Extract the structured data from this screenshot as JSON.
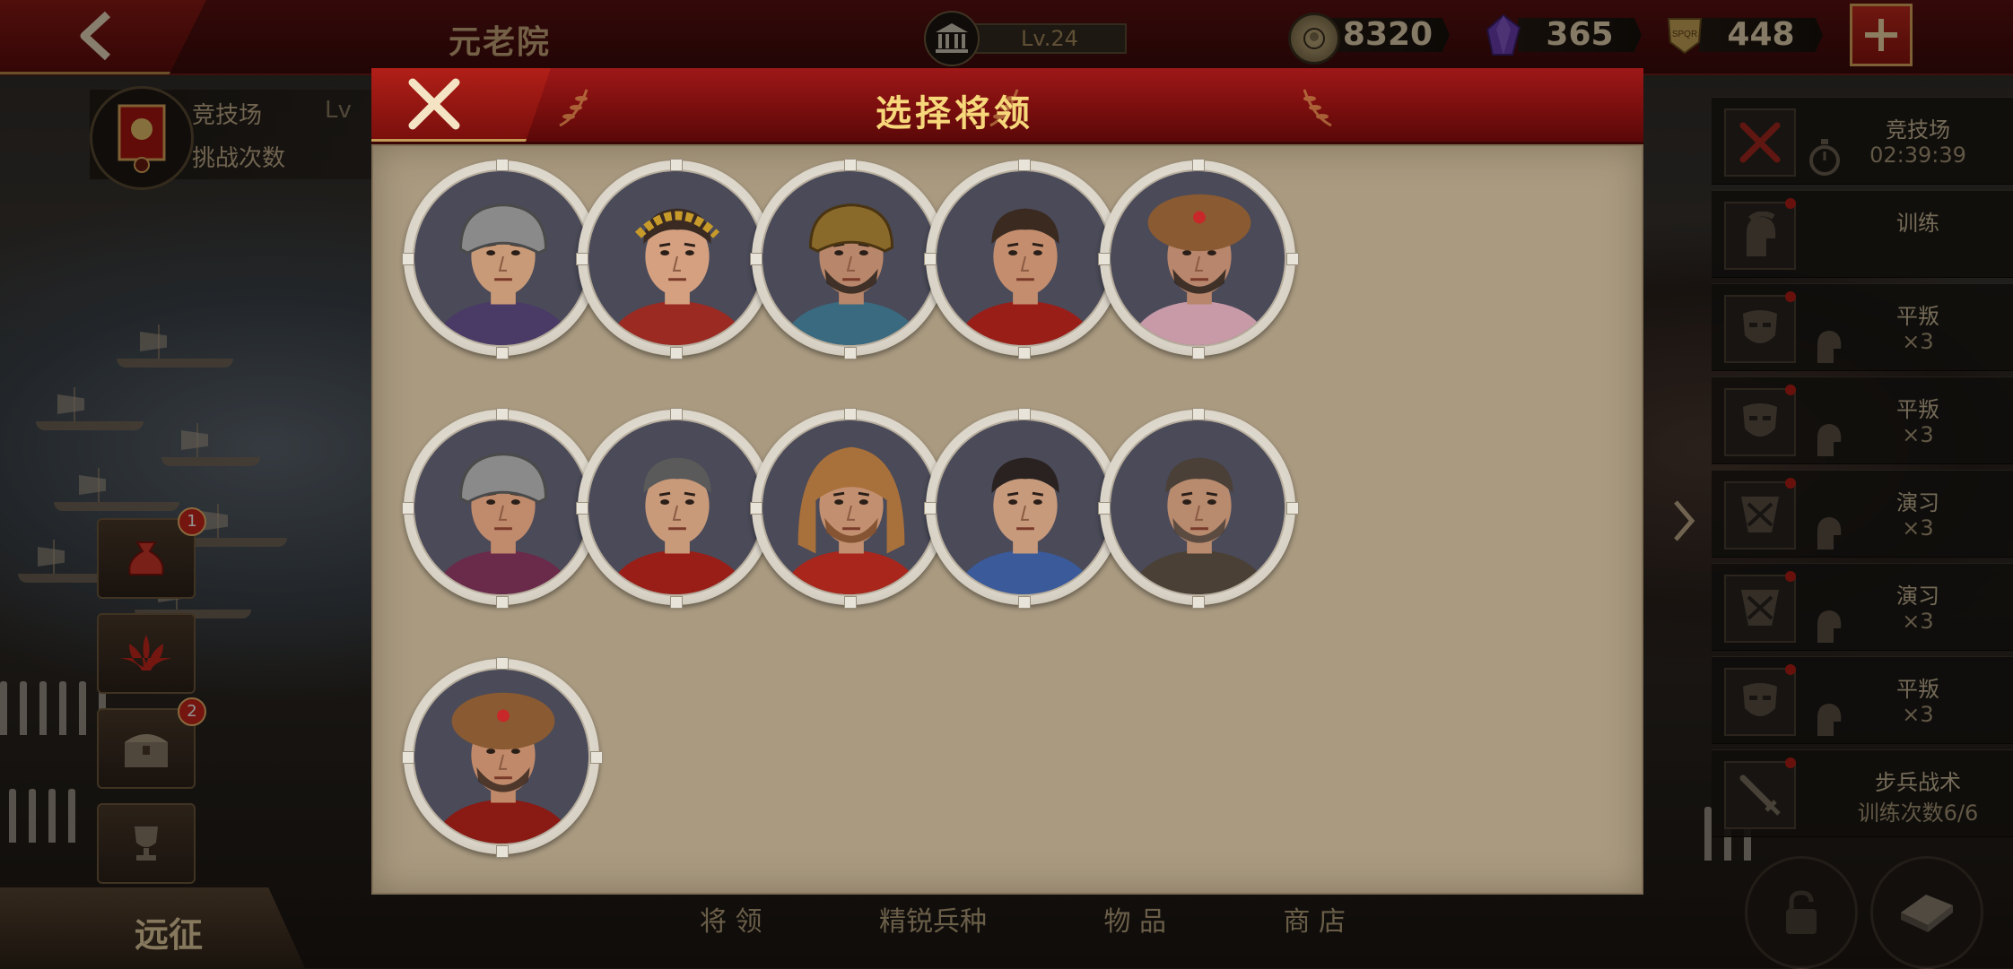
{
  "top_bar": {
    "screen_title": "元老院",
    "level": "Lv.24",
    "resources": [
      {
        "name": "gold",
        "icon": "gold-coin-icon",
        "amount": "8320"
      },
      {
        "name": "gem",
        "icon": "purple-gem-icon",
        "amount": "365"
      },
      {
        "name": "spqr",
        "icon": "spqr-banner-icon",
        "amount": "448"
      }
    ]
  },
  "left_panel": {
    "arena_label": "竞技场",
    "arena_level_partial": "Lv",
    "challenge_label": "挑战次数",
    "expedition_label": "远征",
    "badges": [
      "1",
      "2"
    ]
  },
  "right_panel": {
    "tasks": [
      {
        "icon": "crossed-swords-icon",
        "title": "竞技场",
        "subtitle": "02:39:39"
      },
      {
        "icon": "helmet-icon",
        "title": "训练",
        "subtitle": ""
      },
      {
        "icon": "mask-icon",
        "title": "平叛",
        "subtitle": "×3"
      },
      {
        "icon": "mask-icon",
        "title": "平叛",
        "subtitle": "×3"
      },
      {
        "icon": "crossed-emblem-icon",
        "title": "演习",
        "subtitle": "×3"
      },
      {
        "icon": "crossed-emblem-icon",
        "title": "演习",
        "subtitle": "×3"
      },
      {
        "icon": "mask-icon",
        "title": "平叛",
        "subtitle": "×3"
      },
      {
        "icon": "sword-icon",
        "title": "步兵战术",
        "subtitle": "训练次数6/6"
      }
    ]
  },
  "bottom_nav": {
    "items": [
      "将 领",
      "精锐兵种",
      "物 品",
      "商 店"
    ]
  },
  "modal": {
    "title": "选择将领",
    "generals": [
      {
        "id": "general-1",
        "look": "helmet-crest-plume",
        "skin": "#c99a78",
        "hair": "#4a4a4a",
        "cloth": "#4a3a66"
      },
      {
        "id": "general-2",
        "look": "laurel-wreath",
        "skin": "#d4a080",
        "hair": "#3a2a22",
        "cloth": "#9a2a22"
      },
      {
        "id": "general-3",
        "look": "bronze-helmet-beard",
        "skin": "#b8866a",
        "hair": "#2a221c",
        "cloth": "#3a6a80"
      },
      {
        "id": "general-4",
        "look": "short-hair-red-cloak",
        "skin": "#c48e6e",
        "hair": "#3a2a20",
        "cloth": "#9a1e18"
      },
      {
        "id": "general-5",
        "look": "fur-hat-eastern",
        "skin": "#b8866c",
        "hair": "#2a221c",
        "cloth": "#c89aa8"
      },
      {
        "id": "general-6",
        "look": "steel-helmet-purple",
        "skin": "#c08a6c",
        "hair": "#2a221c",
        "cloth": "#6a2a4a"
      },
      {
        "id": "general-7",
        "look": "short-grey-hair",
        "skin": "#c99a7a",
        "hair": "#5a5a5a",
        "cloth": "#9a1e18"
      },
      {
        "id": "general-8",
        "look": "lion-pelt",
        "skin": "#c29070",
        "hair": "#7a4a28",
        "cloth": "#a8261c"
      },
      {
        "id": "general-9",
        "look": "young-blue-armor",
        "skin": "#c89a7c",
        "hair": "#2a2220",
        "cloth": "#3a5a9a"
      },
      {
        "id": "general-10",
        "look": "older-armored",
        "skin": "#b88a6e",
        "hair": "#4a4038",
        "cloth": "#4a4036"
      },
      {
        "id": "general-11",
        "look": "curly-beard-fur",
        "skin": "#c08a6a",
        "hair": "#3a2820",
        "cloth": "#8a1a14"
      }
    ]
  },
  "colors": {
    "header_red": "#8a1212",
    "gold_text": "#f6d77a",
    "parchment": "#a99a80",
    "badge_red": "#c9271b"
  }
}
